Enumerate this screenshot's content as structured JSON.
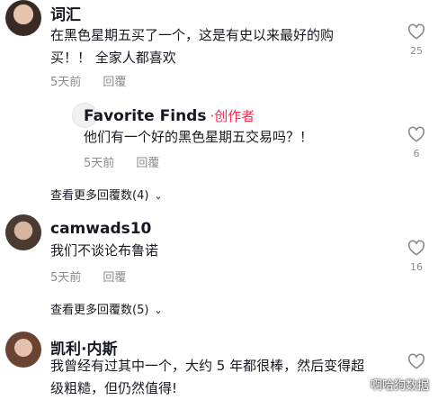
{
  "comments": [
    {
      "username": "词汇",
      "text_line1": "在黑色星期五买了一个，这是有史以来最好的购",
      "text_line2": "买！！ 全家人都喜欢",
      "time": "5天前",
      "reply": "回覆",
      "likes": "25",
      "replies": [
        {
          "username": "Favorite Finds",
          "creator_tag": "·创作者",
          "text": "他们有一个好的黑色星期五交易吗？！",
          "time": "5天前",
          "reply": "回覆",
          "likes": "6"
        }
      ],
      "more_replies": "查看更多回覆数(4)"
    },
    {
      "username": "camwads10",
      "text": "我们不谈论布鲁诺",
      "time": "5天前",
      "reply": "回覆",
      "likes": "16",
      "more_replies": "查看更多回覆数(5)"
    },
    {
      "username": "凯利·内斯",
      "text_line1": "我曾经有过其中一个，大约 5 年都很棒，然后变得超",
      "text_line2": "级粗糙，但仍然值得!"
    }
  ],
  "watermark": "啊哈狗数据",
  "icons": {
    "like": "heart-outline-icon",
    "expand": "chevron-down-icon"
  }
}
